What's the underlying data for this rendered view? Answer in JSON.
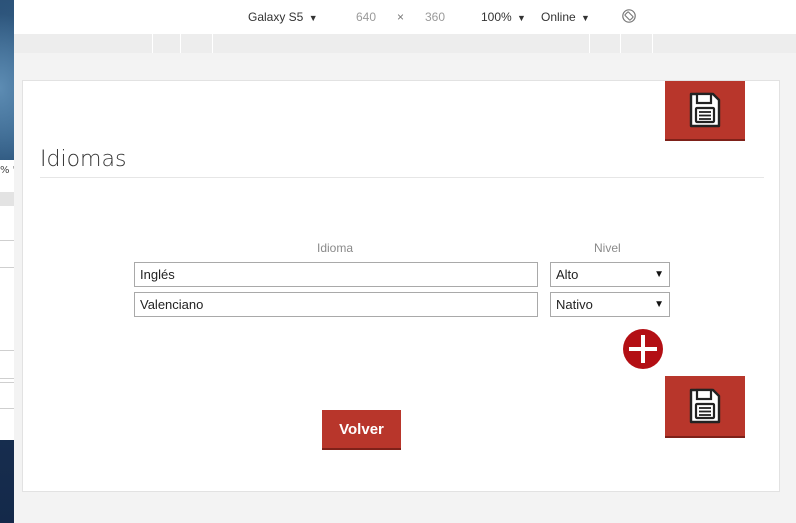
{
  "device_toolbar": {
    "device": "Galaxy S5",
    "width": "640",
    "times": "×",
    "height": "360",
    "zoom": "100%",
    "network": "Online",
    "caret": "▼"
  },
  "left_panel": {
    "text": "% '"
  },
  "page": {
    "title": "Idiomas",
    "columns": {
      "idioma": "Idioma",
      "nivel": "Nivel"
    },
    "rows": [
      {
        "idioma": "Inglés",
        "nivel": "Alto"
      },
      {
        "idioma": "Valenciano",
        "nivel": "Nativo"
      }
    ],
    "volver_label": "Volver"
  },
  "colors": {
    "accent_red": "#b8362b",
    "add_button_red": "#b30f14"
  },
  "icons": {
    "save": "floppy-disk-icon",
    "add": "plus-circle-icon",
    "rotate": "rotate-icon"
  }
}
